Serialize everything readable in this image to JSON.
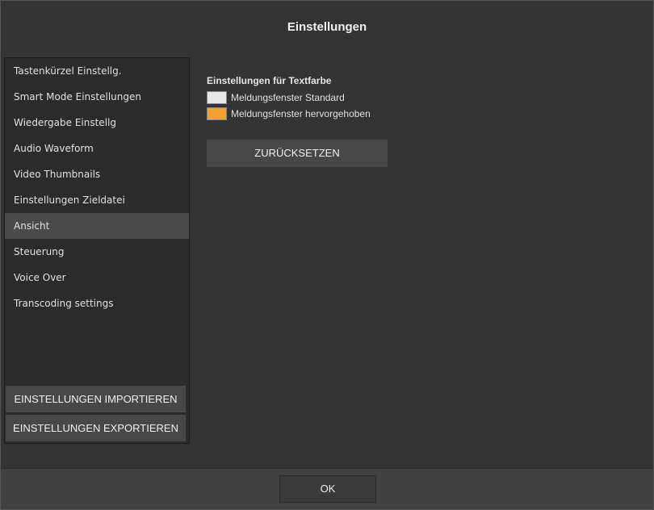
{
  "dialog": {
    "title": "Einstellungen"
  },
  "sidebar": {
    "items": [
      {
        "label": "Tastenkürzel Einstellg."
      },
      {
        "label": "Smart Mode Einstellungen"
      },
      {
        "label": "Wiedergabe Einstellg"
      },
      {
        "label": "Audio Waveform"
      },
      {
        "label": "Video Thumbnails"
      },
      {
        "label": "Einstellungen Zieldatei"
      },
      {
        "label": "Ansicht"
      },
      {
        "label": "Steuerung"
      },
      {
        "label": "Voice Over"
      },
      {
        "label": "Transcoding settings"
      }
    ],
    "active_item": "Ansicht",
    "import_label": "EINSTELLUNGEN IMPORTIEREN",
    "export_label": "EINSTELLUNGEN EXPORTIEREN"
  },
  "content": {
    "section_title": "Einstellungen für Textfarbe",
    "colors": [
      {
        "label": "Meldungsfenster Standard",
        "color": "#e8e8e8"
      },
      {
        "label": "Meldungsfenster hervorgehoben",
        "color": "#f5a030"
      }
    ],
    "reset_label": "ZURÜCKSETZEN"
  },
  "footer": {
    "ok_label": "OK"
  },
  "theme": {
    "background": "#333333",
    "sidebar": "#2b2b2b",
    "active": "#4a4a4a",
    "button": "#474747"
  }
}
